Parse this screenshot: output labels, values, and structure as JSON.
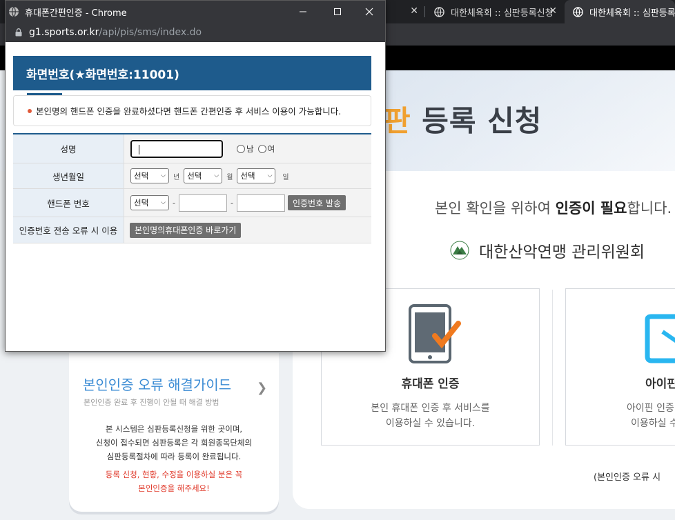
{
  "background": {
    "tabs": [
      {
        "label": ""
      },
      {
        "label": "대한체육회 :: 심판등록신청"
      },
      {
        "label": "대한체육회 :: 심판등록-신"
      }
    ],
    "hero_title_highlight": "판",
    "hero_title_rest": " 등록 신청",
    "confirm_prefix": "본인 확인을 위하여 ",
    "confirm_bold": "인증이 필요",
    "confirm_suffix": "합니다.",
    "org_name": "대한산악연맹 관리위원회",
    "phone_card": {
      "title": "휴대폰 인증",
      "desc1": "본인 휴대폰 인증 후 서비스를",
      "desc2": "이용하실 수 있습니다."
    },
    "ipin_card": {
      "title": "아이핀",
      "desc1": "아이핀 인증",
      "desc2": "이용하실 수"
    },
    "error_link": "(본인인증 오류 시",
    "guide": {
      "title": "본인인증 오류 해결가이드",
      "subtitle": "본인인증 완료 후 진행이 안될 때 해결 방법",
      "body1": "본 시스템은 심판등록신청을 위한 곳이며,",
      "body2": "신청이 접수되면 심판등록은 각 회원종목단체의",
      "body3": "심판등록절차에 따라 등록이 완료됩니다.",
      "red1": "등록 신청, 현황, 수정을 이용하실 분은 꼭",
      "red2": "본인인증을 해주세요!"
    }
  },
  "popup": {
    "window_title": "휴대폰간편인증 - Chrome",
    "url_host": "g1.sports.or.kr",
    "url_path": "/api/pis/sms/index.do",
    "screen_header": "화면번호(★화면번호:11001)",
    "notice": "본인명의 핸드폰 인증을 완료하셨다면 핸드폰 간편인증 후 서비스 이용이 가능합니다.",
    "form": {
      "name_label": "성명",
      "gender_male": "남",
      "gender_female": "여",
      "birth_label": "생년월일",
      "select_placeholder": "선택",
      "unit_year": "년",
      "unit_month": "월",
      "unit_day": "일",
      "phone_label": "핸드폰 번호",
      "dash": "-",
      "send_code_button": "인증번호 발송",
      "error_label": "인증번호 전송 오류 시 이용",
      "self_auth_button": "본인명의휴대폰인증 바로가기"
    }
  }
}
